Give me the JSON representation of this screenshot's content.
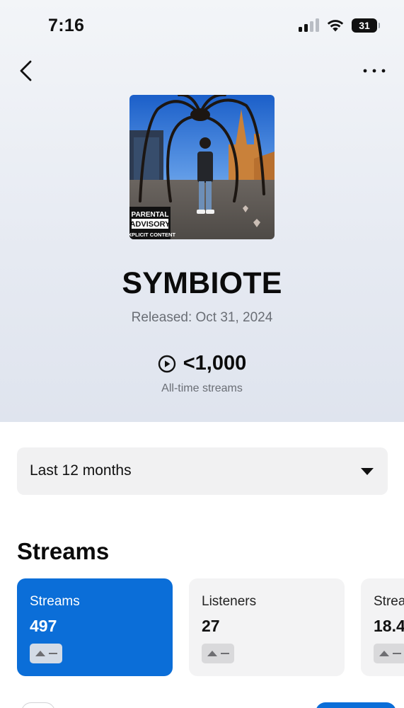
{
  "status_bar": {
    "time": "7:16",
    "battery_level": "31",
    "signal_bars_active": 2,
    "signal_bars_total": 4
  },
  "header": {
    "back_icon": "chevron-left-icon",
    "more_icon": "ellipsis-horizontal-icon"
  },
  "release": {
    "title": "SYMBIOTE",
    "released": "Released: Oct 31, 2024",
    "artwork_badge": [
      "PARENTAL",
      "ADVISORY",
      "EXPLICIT CONTENT"
    ]
  },
  "streams_summary": {
    "icon": "play-circle-icon",
    "count": "<1,000",
    "caption": "All-time streams"
  },
  "filter": {
    "selected": "Last 12 months",
    "icon": "caret-down-icon"
  },
  "section": {
    "title": "Streams"
  },
  "stat_cards": [
    {
      "label": "Streams",
      "value": "497",
      "active": true
    },
    {
      "label": "Listeners",
      "value": "27",
      "active": false
    },
    {
      "label": "Strea",
      "value": "18.4",
      "active": false
    }
  ],
  "colors": {
    "accent": "#0B6ED8",
    "hero_top": "#F3F5F8",
    "hero_bottom": "#DFE4EE",
    "card_bg": "#F3F3F4",
    "muted_text": "#6A6E75"
  }
}
